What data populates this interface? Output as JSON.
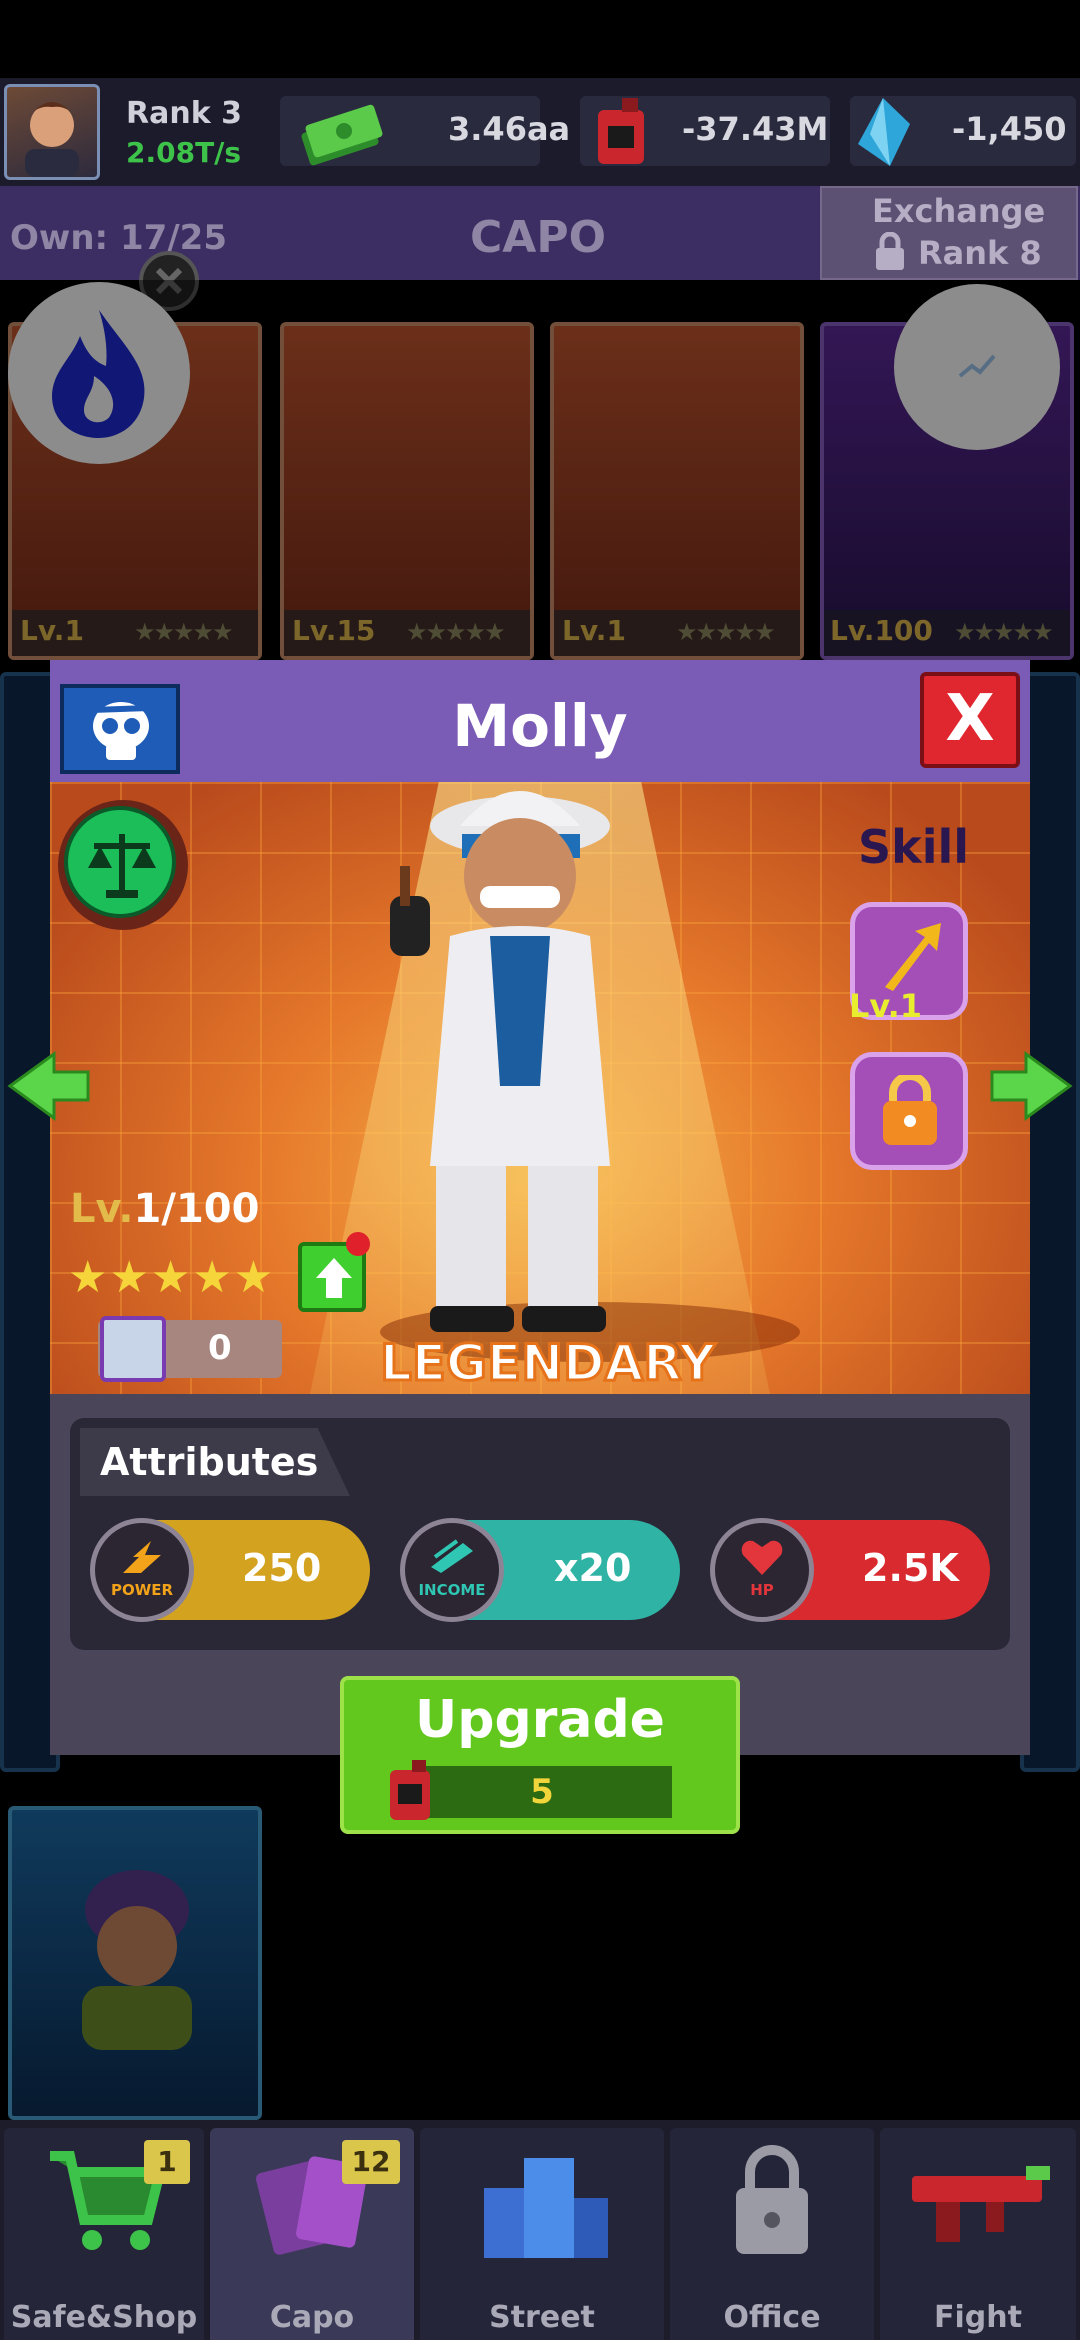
{
  "top_bar": {
    "rank_label": "Rank 3",
    "rate": "2.08T/s",
    "cash": "3.46aa",
    "fuel": "-37.43M",
    "gems": "-1,450"
  },
  "header": {
    "own_label": "Own: 17/25",
    "title": "CAPO",
    "exchange_label": "Exchange",
    "exchange_rank": "Rank 8"
  },
  "cards": [
    {
      "level_prefix": "Lv.",
      "level": "1",
      "stars": "★★★★★"
    },
    {
      "level_prefix": "Lv.",
      "level": "15",
      "stars": "★★★★★"
    },
    {
      "level_prefix": "Lv.",
      "level": "1",
      "stars": "★★★★★"
    },
    {
      "level_prefix": "Lv.",
      "level": "100",
      "stars": "★★★★★"
    }
  ],
  "modal": {
    "name": "Molly",
    "close_label": "X",
    "skill_label": "Skill",
    "skill_level": "Lv.1",
    "level_prefix": "Lv.",
    "level": "1/100",
    "stars": "★★★★★",
    "shards": "0",
    "rarity": "LEGENDARY",
    "attributes_title": "Attributes",
    "attributes": {
      "power_label": "POWER",
      "power_value": "250",
      "income_label": "INCOME",
      "income_value": "x20",
      "hp_label": "HP",
      "hp_value": "2.5K"
    },
    "upgrade_label": "Upgrade",
    "upgrade_cost": "5"
  },
  "nav": [
    {
      "label": "Safe&Shop",
      "badge": "1"
    },
    {
      "label": "Capo",
      "badge": "12"
    },
    {
      "label": "Street",
      "badge": ""
    },
    {
      "label": "Office",
      "badge": ""
    },
    {
      "label": "Fight",
      "badge": ""
    }
  ],
  "colors": {
    "accent_purple": "#7a5bb6",
    "upgrade_green": "#62c81e",
    "power": "#d3a21f",
    "income": "#2fb3a4",
    "hp": "#d82a2f",
    "level_gold": "#e2bb4b"
  }
}
